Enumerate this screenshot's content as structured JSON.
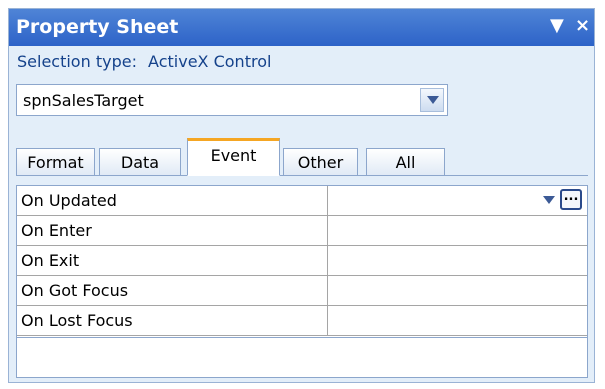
{
  "window": {
    "title": "Property Sheet",
    "menu_glyph": "▼",
    "close_glyph": "×"
  },
  "selection": {
    "label": "Selection type:",
    "value": "ActiveX Control"
  },
  "object_combo": {
    "value": "spnSalesTarget"
  },
  "tabs": [
    {
      "label": "Format",
      "active": false
    },
    {
      "label": "Data",
      "active": false
    },
    {
      "label": "Event",
      "active": true
    },
    {
      "label": "Other",
      "active": false
    },
    {
      "label": "All",
      "active": false
    }
  ],
  "properties": [
    {
      "name": "On Updated",
      "value": ""
    },
    {
      "name": "On Enter",
      "value": ""
    },
    {
      "name": "On Exit",
      "value": ""
    },
    {
      "name": "On Got Focus",
      "value": ""
    },
    {
      "name": "On Lost Focus",
      "value": ""
    }
  ],
  "builder_button": {
    "label": "..."
  },
  "colors": {
    "title_bar": "#3a6fcf",
    "pane_bg": "#e3eef9",
    "active_tab_accent": "#f5a623",
    "selection_text": "#15428b"
  }
}
